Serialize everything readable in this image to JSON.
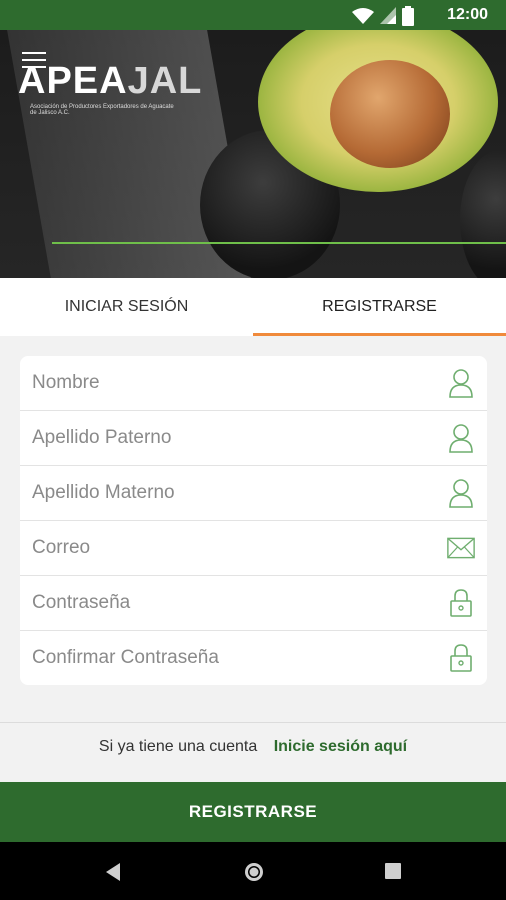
{
  "status_bar": {
    "time": "12:00"
  },
  "brand": {
    "logo_primary": "APEA",
    "logo_secondary": "JAL",
    "logo_subtitle": "Asociación de Productores Exportadores de Aguacate de Jalisco A.C."
  },
  "tabs": [
    {
      "label": "INICIAR SESIÓN",
      "active": false
    },
    {
      "label": "REGISTRARSE",
      "active": true
    }
  ],
  "form": {
    "fields": [
      {
        "placeholder": "Nombre",
        "icon": "user-icon"
      },
      {
        "placeholder": "Apellido Paterno",
        "icon": "user-icon"
      },
      {
        "placeholder": "Apellido Materno",
        "icon": "user-icon"
      },
      {
        "placeholder": "Correo",
        "icon": "envelope-icon"
      },
      {
        "placeholder": "Contraseña",
        "icon": "lock-icon"
      },
      {
        "placeholder": "Confirmar Contraseña",
        "icon": "lock-icon"
      }
    ]
  },
  "footer": {
    "prompt": "Si ya tiene una cuenta",
    "link": "Inicie sesión aquí",
    "cta": "REGISTRARSE"
  },
  "colors": {
    "primary": "#2e6b2e",
    "accent": "#f08a3b"
  }
}
